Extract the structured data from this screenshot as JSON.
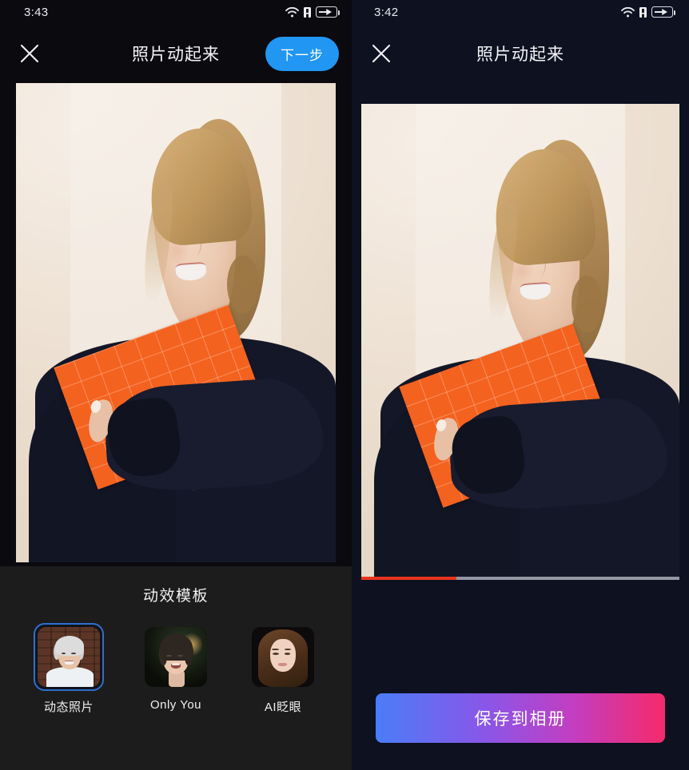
{
  "left_screen": {
    "status_bar": {
      "time": "3:43",
      "icons": [
        "wifi-icon",
        "alert-icon",
        "battery-charging-icon"
      ]
    },
    "nav": {
      "close_label": "close-icon",
      "title": "照片动起来",
      "next_label": "下一步"
    },
    "photo": {
      "alt": "blonde woman smiling holding orange folder",
      "accent_folder_color": "#f4621f",
      "background_color": "#ece0d4"
    },
    "templates": {
      "section_title": "动效模板",
      "items": [
        {
          "label": "动态照片",
          "selected": true,
          "thumb": "elderly-woman-brick-background"
        },
        {
          "label": "Only You",
          "selected": false,
          "thumb": "young-woman-singing-dark-green"
        },
        {
          "label": "AI眨眼",
          "selected": false,
          "thumb": "brunette-woman-dark-background"
        }
      ]
    }
  },
  "right_screen": {
    "status_bar": {
      "time": "3:42",
      "icons": [
        "wifi-icon",
        "alert-icon",
        "battery-charging-icon"
      ]
    },
    "nav": {
      "close_label": "close-icon",
      "title": "照片动起来"
    },
    "video": {
      "alt": "animated result of blonde woman portrait",
      "progress_percent": 30,
      "progress_color": "#e8361f"
    },
    "save_button": {
      "label": "保存到相册"
    }
  },
  "colors": {
    "next_button": "#2196f3",
    "selection_border": "#2f6fd0",
    "left_background": "#0a0a0f",
    "right_background": "#0d1120",
    "panel_background": "#1c1c1c",
    "save_gradient_start": "#4a7df8",
    "save_gradient_end": "#f52a6a"
  }
}
